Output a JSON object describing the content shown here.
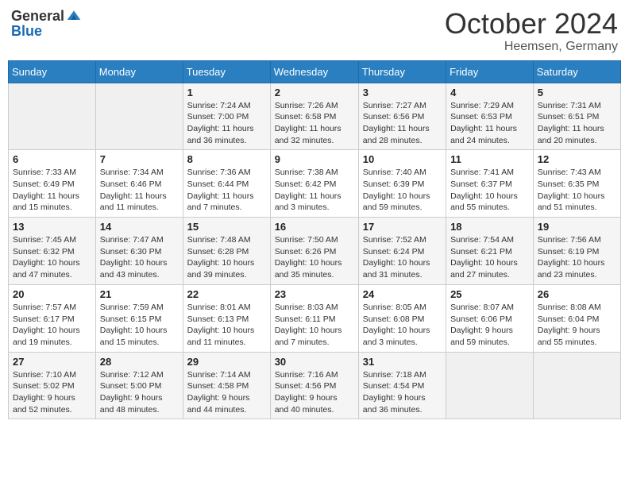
{
  "header": {
    "logo_general": "General",
    "logo_blue": "Blue",
    "month": "October 2024",
    "location": "Heemsen, Germany"
  },
  "weekdays": [
    "Sunday",
    "Monday",
    "Tuesday",
    "Wednesday",
    "Thursday",
    "Friday",
    "Saturday"
  ],
  "weeks": [
    [
      {
        "day": "",
        "info": ""
      },
      {
        "day": "",
        "info": ""
      },
      {
        "day": "1",
        "info": "Sunrise: 7:24 AM\nSunset: 7:00 PM\nDaylight: 11 hours\nand 36 minutes."
      },
      {
        "day": "2",
        "info": "Sunrise: 7:26 AM\nSunset: 6:58 PM\nDaylight: 11 hours\nand 32 minutes."
      },
      {
        "day": "3",
        "info": "Sunrise: 7:27 AM\nSunset: 6:56 PM\nDaylight: 11 hours\nand 28 minutes."
      },
      {
        "day": "4",
        "info": "Sunrise: 7:29 AM\nSunset: 6:53 PM\nDaylight: 11 hours\nand 24 minutes."
      },
      {
        "day": "5",
        "info": "Sunrise: 7:31 AM\nSunset: 6:51 PM\nDaylight: 11 hours\nand 20 minutes."
      }
    ],
    [
      {
        "day": "6",
        "info": "Sunrise: 7:33 AM\nSunset: 6:49 PM\nDaylight: 11 hours\nand 15 minutes."
      },
      {
        "day": "7",
        "info": "Sunrise: 7:34 AM\nSunset: 6:46 PM\nDaylight: 11 hours\nand 11 minutes."
      },
      {
        "day": "8",
        "info": "Sunrise: 7:36 AM\nSunset: 6:44 PM\nDaylight: 11 hours\nand 7 minutes."
      },
      {
        "day": "9",
        "info": "Sunrise: 7:38 AM\nSunset: 6:42 PM\nDaylight: 11 hours\nand 3 minutes."
      },
      {
        "day": "10",
        "info": "Sunrise: 7:40 AM\nSunset: 6:39 PM\nDaylight: 10 hours\nand 59 minutes."
      },
      {
        "day": "11",
        "info": "Sunrise: 7:41 AM\nSunset: 6:37 PM\nDaylight: 10 hours\nand 55 minutes."
      },
      {
        "day": "12",
        "info": "Sunrise: 7:43 AM\nSunset: 6:35 PM\nDaylight: 10 hours\nand 51 minutes."
      }
    ],
    [
      {
        "day": "13",
        "info": "Sunrise: 7:45 AM\nSunset: 6:32 PM\nDaylight: 10 hours\nand 47 minutes."
      },
      {
        "day": "14",
        "info": "Sunrise: 7:47 AM\nSunset: 6:30 PM\nDaylight: 10 hours\nand 43 minutes."
      },
      {
        "day": "15",
        "info": "Sunrise: 7:48 AM\nSunset: 6:28 PM\nDaylight: 10 hours\nand 39 minutes."
      },
      {
        "day": "16",
        "info": "Sunrise: 7:50 AM\nSunset: 6:26 PM\nDaylight: 10 hours\nand 35 minutes."
      },
      {
        "day": "17",
        "info": "Sunrise: 7:52 AM\nSunset: 6:24 PM\nDaylight: 10 hours\nand 31 minutes."
      },
      {
        "day": "18",
        "info": "Sunrise: 7:54 AM\nSunset: 6:21 PM\nDaylight: 10 hours\nand 27 minutes."
      },
      {
        "day": "19",
        "info": "Sunrise: 7:56 AM\nSunset: 6:19 PM\nDaylight: 10 hours\nand 23 minutes."
      }
    ],
    [
      {
        "day": "20",
        "info": "Sunrise: 7:57 AM\nSunset: 6:17 PM\nDaylight: 10 hours\nand 19 minutes."
      },
      {
        "day": "21",
        "info": "Sunrise: 7:59 AM\nSunset: 6:15 PM\nDaylight: 10 hours\nand 15 minutes."
      },
      {
        "day": "22",
        "info": "Sunrise: 8:01 AM\nSunset: 6:13 PM\nDaylight: 10 hours\nand 11 minutes."
      },
      {
        "day": "23",
        "info": "Sunrise: 8:03 AM\nSunset: 6:11 PM\nDaylight: 10 hours\nand 7 minutes."
      },
      {
        "day": "24",
        "info": "Sunrise: 8:05 AM\nSunset: 6:08 PM\nDaylight: 10 hours\nand 3 minutes."
      },
      {
        "day": "25",
        "info": "Sunrise: 8:07 AM\nSunset: 6:06 PM\nDaylight: 9 hours\nand 59 minutes."
      },
      {
        "day": "26",
        "info": "Sunrise: 8:08 AM\nSunset: 6:04 PM\nDaylight: 9 hours\nand 55 minutes."
      }
    ],
    [
      {
        "day": "27",
        "info": "Sunrise: 7:10 AM\nSunset: 5:02 PM\nDaylight: 9 hours\nand 52 minutes."
      },
      {
        "day": "28",
        "info": "Sunrise: 7:12 AM\nSunset: 5:00 PM\nDaylight: 9 hours\nand 48 minutes."
      },
      {
        "day": "29",
        "info": "Sunrise: 7:14 AM\nSunset: 4:58 PM\nDaylight: 9 hours\nand 44 minutes."
      },
      {
        "day": "30",
        "info": "Sunrise: 7:16 AM\nSunset: 4:56 PM\nDaylight: 9 hours\nand 40 minutes."
      },
      {
        "day": "31",
        "info": "Sunrise: 7:18 AM\nSunset: 4:54 PM\nDaylight: 9 hours\nand 36 minutes."
      },
      {
        "day": "",
        "info": ""
      },
      {
        "day": "",
        "info": ""
      }
    ]
  ]
}
